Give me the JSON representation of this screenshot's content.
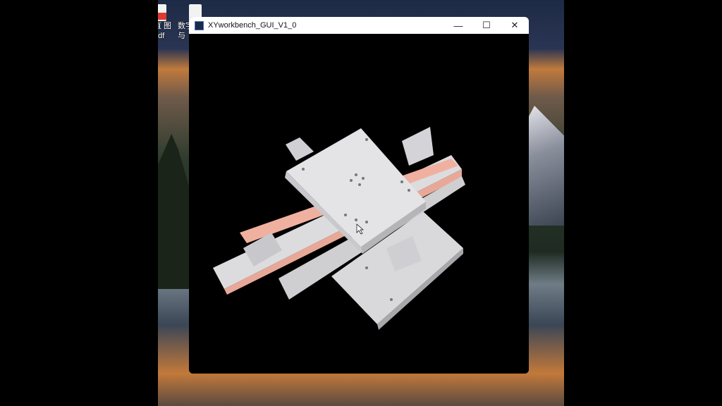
{
  "desktop": {
    "icons": [
      {
        "line1": "直 图",
        "line2": "pdf"
      },
      {
        "line1": "数字",
        "line2": "与"
      }
    ]
  },
  "window": {
    "title": "XYworkbench_GUI_V1_0",
    "minimize": "—",
    "maximize": "☐",
    "close": "✕"
  }
}
